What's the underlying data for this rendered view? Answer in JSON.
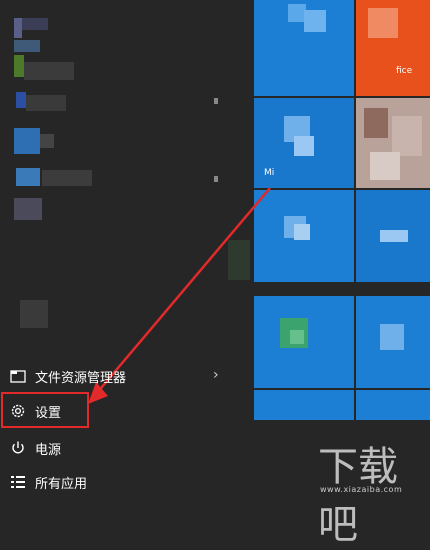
{
  "menu": {
    "file_explorer_label": "文件资源管理器",
    "settings_label": "设置",
    "power_label": "电源",
    "all_apps_label": "所有应用"
  },
  "tiles": {
    "tile_a_label": "fice",
    "tile_b_label": "Mi"
  },
  "watermark": {
    "brand": "下载吧",
    "url": "www.xiazaiba.com"
  },
  "colors": {
    "accent_red": "#e22a2a",
    "tile_blue": "#1a7fd6",
    "tile_orange": "#e8501c",
    "background": "#262626"
  },
  "icons": {
    "file_explorer": "folder-icon",
    "settings": "gear-icon",
    "power": "power-icon",
    "all_apps": "list-icon",
    "chevron": "chevron-right-icon"
  }
}
